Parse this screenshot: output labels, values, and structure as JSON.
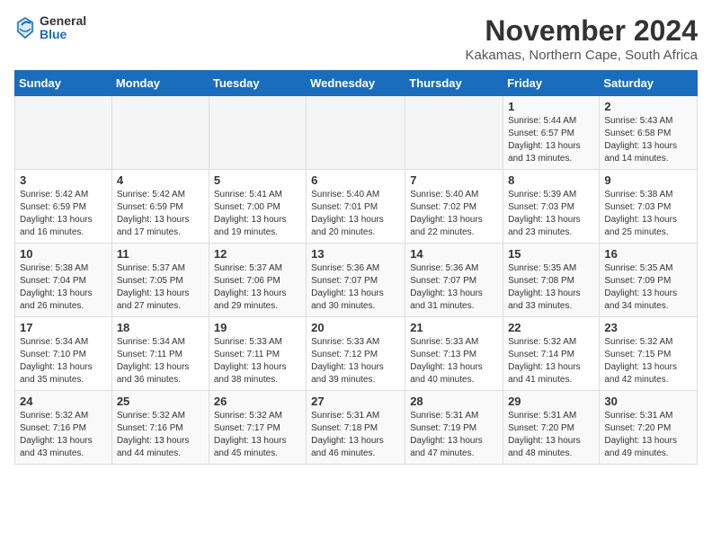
{
  "header": {
    "logo_general": "General",
    "logo_blue": "Blue",
    "month_title": "November 2024",
    "subtitle": "Kakamas, Northern Cape, South Africa"
  },
  "days_of_week": [
    "Sunday",
    "Monday",
    "Tuesday",
    "Wednesday",
    "Thursday",
    "Friday",
    "Saturday"
  ],
  "weeks": [
    [
      {
        "day": "",
        "info": ""
      },
      {
        "day": "",
        "info": ""
      },
      {
        "day": "",
        "info": ""
      },
      {
        "day": "",
        "info": ""
      },
      {
        "day": "",
        "info": ""
      },
      {
        "day": "1",
        "info": "Sunrise: 5:44 AM\nSunset: 6:57 PM\nDaylight: 13 hours\nand 13 minutes."
      },
      {
        "day": "2",
        "info": "Sunrise: 5:43 AM\nSunset: 6:58 PM\nDaylight: 13 hours\nand 14 minutes."
      }
    ],
    [
      {
        "day": "3",
        "info": "Sunrise: 5:42 AM\nSunset: 6:59 PM\nDaylight: 13 hours\nand 16 minutes."
      },
      {
        "day": "4",
        "info": "Sunrise: 5:42 AM\nSunset: 6:59 PM\nDaylight: 13 hours\nand 17 minutes."
      },
      {
        "day": "5",
        "info": "Sunrise: 5:41 AM\nSunset: 7:00 PM\nDaylight: 13 hours\nand 19 minutes."
      },
      {
        "day": "6",
        "info": "Sunrise: 5:40 AM\nSunset: 7:01 PM\nDaylight: 13 hours\nand 20 minutes."
      },
      {
        "day": "7",
        "info": "Sunrise: 5:40 AM\nSunset: 7:02 PM\nDaylight: 13 hours\nand 22 minutes."
      },
      {
        "day": "8",
        "info": "Sunrise: 5:39 AM\nSunset: 7:03 PM\nDaylight: 13 hours\nand 23 minutes."
      },
      {
        "day": "9",
        "info": "Sunrise: 5:38 AM\nSunset: 7:03 PM\nDaylight: 13 hours\nand 25 minutes."
      }
    ],
    [
      {
        "day": "10",
        "info": "Sunrise: 5:38 AM\nSunset: 7:04 PM\nDaylight: 13 hours\nand 26 minutes."
      },
      {
        "day": "11",
        "info": "Sunrise: 5:37 AM\nSunset: 7:05 PM\nDaylight: 13 hours\nand 27 minutes."
      },
      {
        "day": "12",
        "info": "Sunrise: 5:37 AM\nSunset: 7:06 PM\nDaylight: 13 hours\nand 29 minutes."
      },
      {
        "day": "13",
        "info": "Sunrise: 5:36 AM\nSunset: 7:07 PM\nDaylight: 13 hours\nand 30 minutes."
      },
      {
        "day": "14",
        "info": "Sunrise: 5:36 AM\nSunset: 7:07 PM\nDaylight: 13 hours\nand 31 minutes."
      },
      {
        "day": "15",
        "info": "Sunrise: 5:35 AM\nSunset: 7:08 PM\nDaylight: 13 hours\nand 33 minutes."
      },
      {
        "day": "16",
        "info": "Sunrise: 5:35 AM\nSunset: 7:09 PM\nDaylight: 13 hours\nand 34 minutes."
      }
    ],
    [
      {
        "day": "17",
        "info": "Sunrise: 5:34 AM\nSunset: 7:10 PM\nDaylight: 13 hours\nand 35 minutes."
      },
      {
        "day": "18",
        "info": "Sunrise: 5:34 AM\nSunset: 7:11 PM\nDaylight: 13 hours\nand 36 minutes."
      },
      {
        "day": "19",
        "info": "Sunrise: 5:33 AM\nSunset: 7:11 PM\nDaylight: 13 hours\nand 38 minutes."
      },
      {
        "day": "20",
        "info": "Sunrise: 5:33 AM\nSunset: 7:12 PM\nDaylight: 13 hours\nand 39 minutes."
      },
      {
        "day": "21",
        "info": "Sunrise: 5:33 AM\nSunset: 7:13 PM\nDaylight: 13 hours\nand 40 minutes."
      },
      {
        "day": "22",
        "info": "Sunrise: 5:32 AM\nSunset: 7:14 PM\nDaylight: 13 hours\nand 41 minutes."
      },
      {
        "day": "23",
        "info": "Sunrise: 5:32 AM\nSunset: 7:15 PM\nDaylight: 13 hours\nand 42 minutes."
      }
    ],
    [
      {
        "day": "24",
        "info": "Sunrise: 5:32 AM\nSunset: 7:16 PM\nDaylight: 13 hours\nand 43 minutes."
      },
      {
        "day": "25",
        "info": "Sunrise: 5:32 AM\nSunset: 7:16 PM\nDaylight: 13 hours\nand 44 minutes."
      },
      {
        "day": "26",
        "info": "Sunrise: 5:32 AM\nSunset: 7:17 PM\nDaylight: 13 hours\nand 45 minutes."
      },
      {
        "day": "27",
        "info": "Sunrise: 5:31 AM\nSunset: 7:18 PM\nDaylight: 13 hours\nand 46 minutes."
      },
      {
        "day": "28",
        "info": "Sunrise: 5:31 AM\nSunset: 7:19 PM\nDaylight: 13 hours\nand 47 minutes."
      },
      {
        "day": "29",
        "info": "Sunrise: 5:31 AM\nSunset: 7:20 PM\nDaylight: 13 hours\nand 48 minutes."
      },
      {
        "day": "30",
        "info": "Sunrise: 5:31 AM\nSunset: 7:20 PM\nDaylight: 13 hours\nand 49 minutes."
      }
    ]
  ]
}
